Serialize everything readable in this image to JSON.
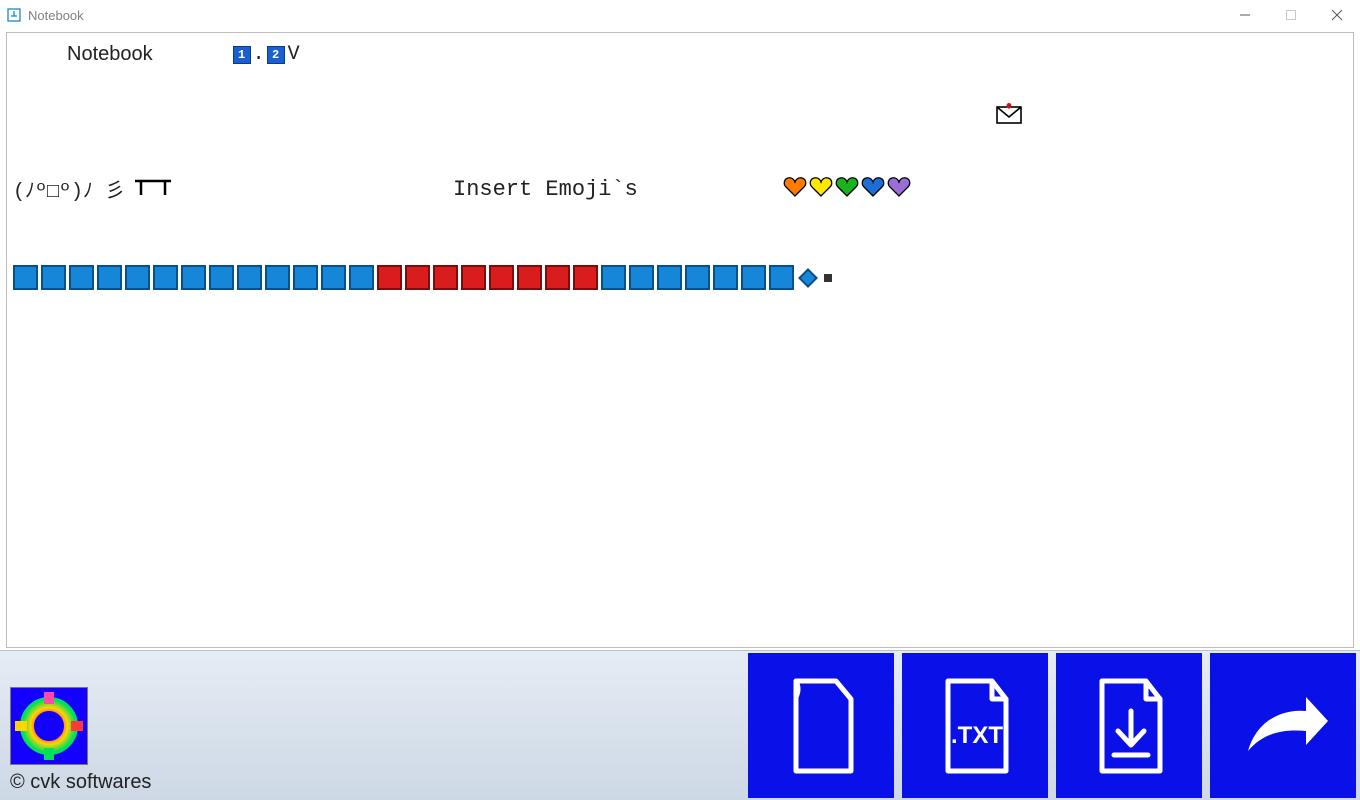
{
  "window": {
    "title": "Notebook"
  },
  "header": {
    "app_name": "Notebook",
    "version_major": "1",
    "version_dot": ".",
    "version_minor": "2",
    "version_suffix": "V"
  },
  "emoji_section": {
    "kaomoji": "(ﾉº□º)ﾉ 彡",
    "label": "Insert Emoji`s",
    "hearts": [
      "#ff7b00",
      "#ffe600",
      "#1bb31b",
      "#1b6ed6",
      "#9a6dd7"
    ]
  },
  "squares": {
    "sequence": [
      "blue",
      "blue",
      "blue",
      "blue",
      "blue",
      "blue",
      "blue",
      "blue",
      "blue",
      "blue",
      "blue",
      "blue",
      "blue",
      "red",
      "red",
      "red",
      "red",
      "red",
      "red",
      "red",
      "red",
      "blue",
      "blue",
      "blue",
      "blue",
      "blue",
      "blue",
      "blue"
    ]
  },
  "footer": {
    "copyright": "© cvk softwares",
    "txt_label": ".TXT"
  }
}
